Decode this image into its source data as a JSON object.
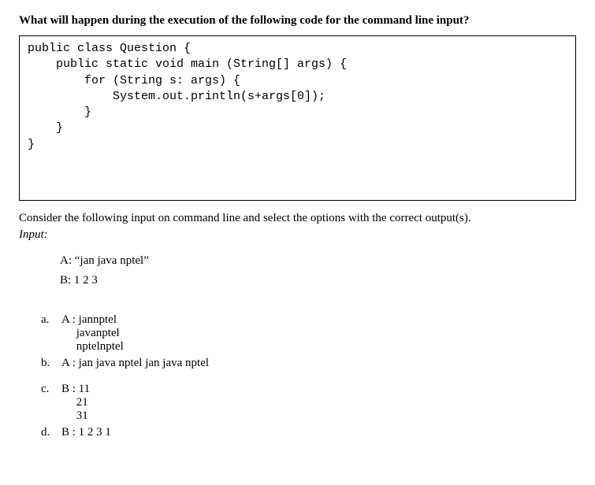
{
  "question": {
    "title": "What will happen during the execution of the following code for the command line input?",
    "code": "public class Question {\n    public static void main (String[] args) {\n        for (String s: args) {\n            System.out.println(s+args[0]);\n        }\n    }\n}",
    "consider": "Consider the following input on command line and select the options with the correct output(s).",
    "input_label": "Input:",
    "inputs": {
      "a": "A: “jan java nptel”",
      "b": "B: 1 2 3"
    },
    "options": [
      {
        "letter": "a.",
        "text": "A : jannptel\n     javanptel\n     nptelnptel"
      },
      {
        "letter": "b.",
        "text": "A : jan java nptel jan java nptel"
      },
      {
        "letter": "c.",
        "text": "B : 11\n     21\n     31"
      },
      {
        "letter": "d.",
        "text": "B : 1 2 3 1"
      }
    ]
  }
}
